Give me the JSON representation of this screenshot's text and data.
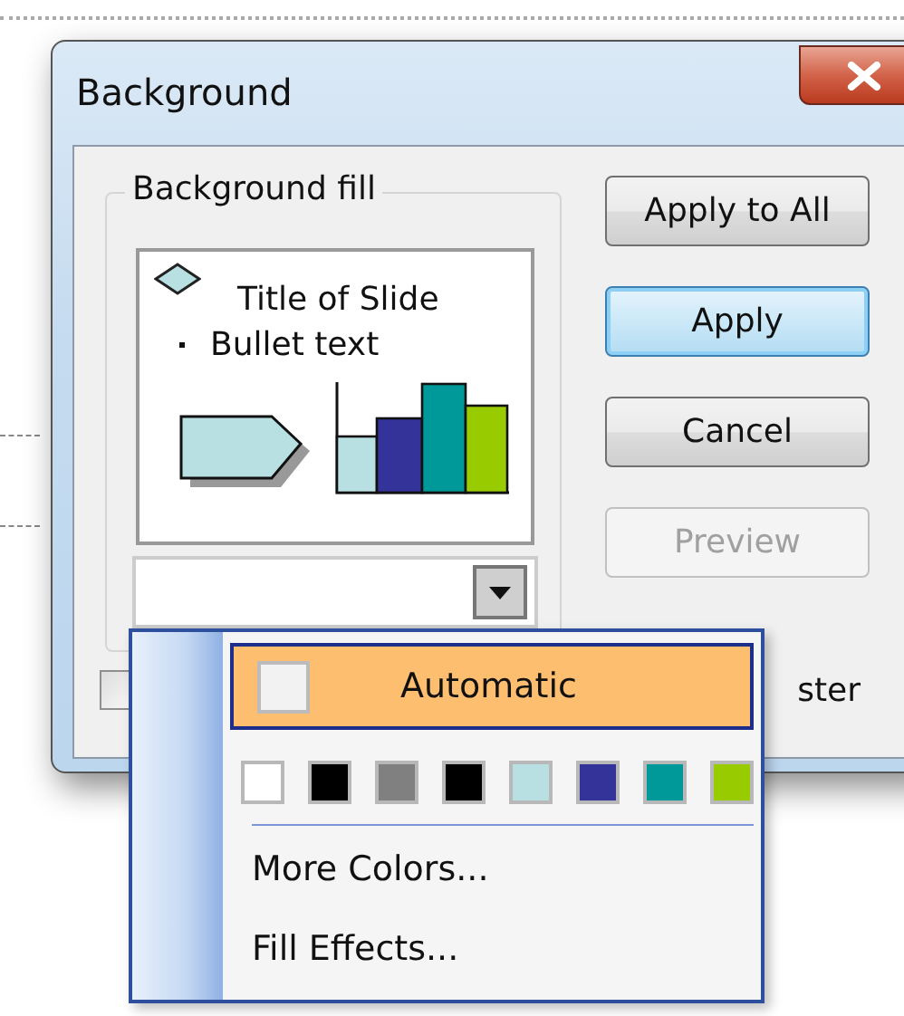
{
  "dialog": {
    "title": "Background",
    "group": {
      "label": "Background fill",
      "preview": {
        "title": "Title of Slide",
        "bullet": "Bullet text"
      }
    },
    "dropdown": {
      "expanded": true
    },
    "buttons": [
      {
        "label": "Apply to All",
        "focused": false,
        "disabled": false
      },
      {
        "label": "Apply",
        "focused": true,
        "disabled": false
      },
      {
        "label": "Cancel",
        "focused": false,
        "disabled": false
      },
      {
        "label": "Preview",
        "focused": false,
        "disabled": true
      }
    ],
    "checkbox": {
      "label": "ster",
      "checked": false
    }
  },
  "color_menu": {
    "automatic": {
      "label": "Automatic",
      "selected": true
    },
    "swatches": [
      {
        "color": "#ffffff",
        "selected": false
      },
      {
        "color": "#000000",
        "selected": false
      },
      {
        "color": "#808080",
        "selected": false
      },
      {
        "color": "#000000",
        "selected": false
      },
      {
        "color": "#b8e0e3",
        "selected": false
      },
      {
        "color": "#333399",
        "selected": false
      },
      {
        "color": "#009999",
        "selected": false
      },
      {
        "color": "#99cc00",
        "selected": false
      }
    ],
    "items": [
      {
        "label": "More Colors..."
      },
      {
        "label": "Fill Effects..."
      }
    ]
  }
}
